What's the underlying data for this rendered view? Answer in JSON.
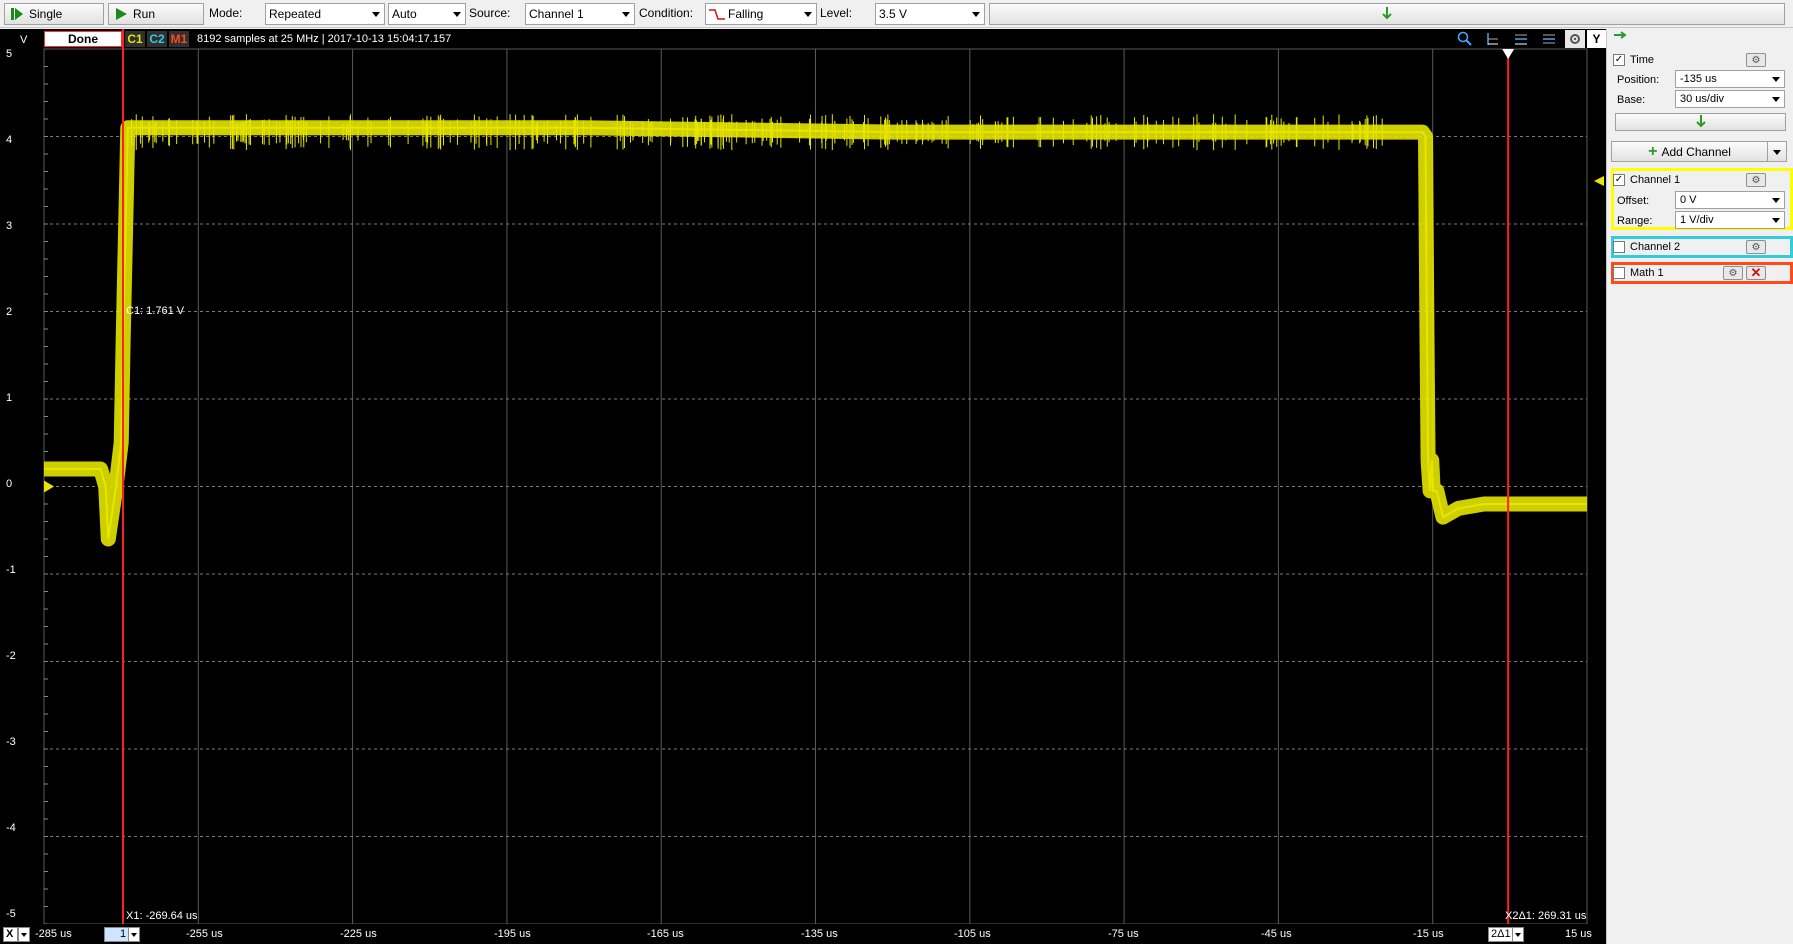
{
  "toolbar": {
    "single_label": "Single",
    "run_label": "Run",
    "mode_label": "Mode:",
    "mode_value": "Repeated",
    "trigger_value": "Auto",
    "source_label": "Source:",
    "source_value": "Channel 1",
    "condition_label": "Condition:",
    "condition_value": "Falling",
    "level_label": "Level:",
    "level_value": "3.5 V"
  },
  "scope": {
    "status": "Done",
    "channel_tags": [
      "C1",
      "C2",
      "M1"
    ],
    "samples_info": "8192 samples at 25 MHz | 2017-10-13 15:04:17.157",
    "y_unit": "V",
    "y_button": "Y",
    "y_ticks": [
      "5",
      "4",
      "3",
      "2",
      "1",
      "0",
      "-1",
      "-2",
      "-3",
      "-4",
      "-5"
    ],
    "x_ticks": [
      "-285 us",
      "-255 us",
      "-225 us",
      "-195 us",
      "-165 us",
      "-135 us",
      "-105 us",
      "-75 us",
      "-45 us",
      "-15 us",
      "15 us"
    ],
    "x_button": "X",
    "x_cursor_select": "1",
    "x_cursor2_select": "2Δ1",
    "c1_readout": "C1: 1.761 V",
    "x1_readout": "X1: -269.64 us",
    "x2_readout": "X2Δ1: 269.31 us",
    "colors": {
      "channel1": "#e6e600",
      "channel2": "#33ccdd",
      "math1": "#ff4a1a",
      "cursor": "#ff2020",
      "grid": "#5a5a5a"
    }
  },
  "chart_data": {
    "type": "line",
    "xlabel": "us",
    "ylabel": "V",
    "xlim": [
      -285,
      15
    ],
    "ylim": [
      -5,
      5
    ],
    "grid": true,
    "series": [
      {
        "name": "Channel 1",
        "x": [
          -285,
          -274,
          -273,
          -272.5,
          -271,
          -270,
          -269.6,
          -269,
          -268.7,
          -240,
          -180,
          -120,
          -60,
          -30,
          -17,
          -16.4,
          -16.1,
          -15.9,
          -15.5,
          -15.2,
          -14.9,
          -14.2,
          -13,
          -10,
          -5,
          0,
          15
        ],
        "y": [
          0.2,
          0.2,
          0.0,
          -0.6,
          0.0,
          0.5,
          1.7,
          3.3,
          4.1,
          4.1,
          4.1,
          4.05,
          4.05,
          4.05,
          4.05,
          4.0,
          1.7,
          0.3,
          -0.05,
          0.3,
          -0.05,
          -0.05,
          -0.35,
          -0.25,
          -0.2,
          -0.2,
          -0.2
        ]
      }
    ],
    "cursors": {
      "x1": -269.64,
      "x2": -0.33
    }
  },
  "panel": {
    "time_label": "Time",
    "position_label": "Position:",
    "position_value": "-135 us",
    "base_label": "Base:",
    "base_value": "30 us/div",
    "add_channel_label": "Add Channel",
    "channel1_label": "Channel 1",
    "offset_label": "Offset:",
    "offset_value": "0 V",
    "range_label": "Range:",
    "range_value": "1 V/div",
    "channel2_label": "Channel 2",
    "math1_label": "Math 1"
  }
}
